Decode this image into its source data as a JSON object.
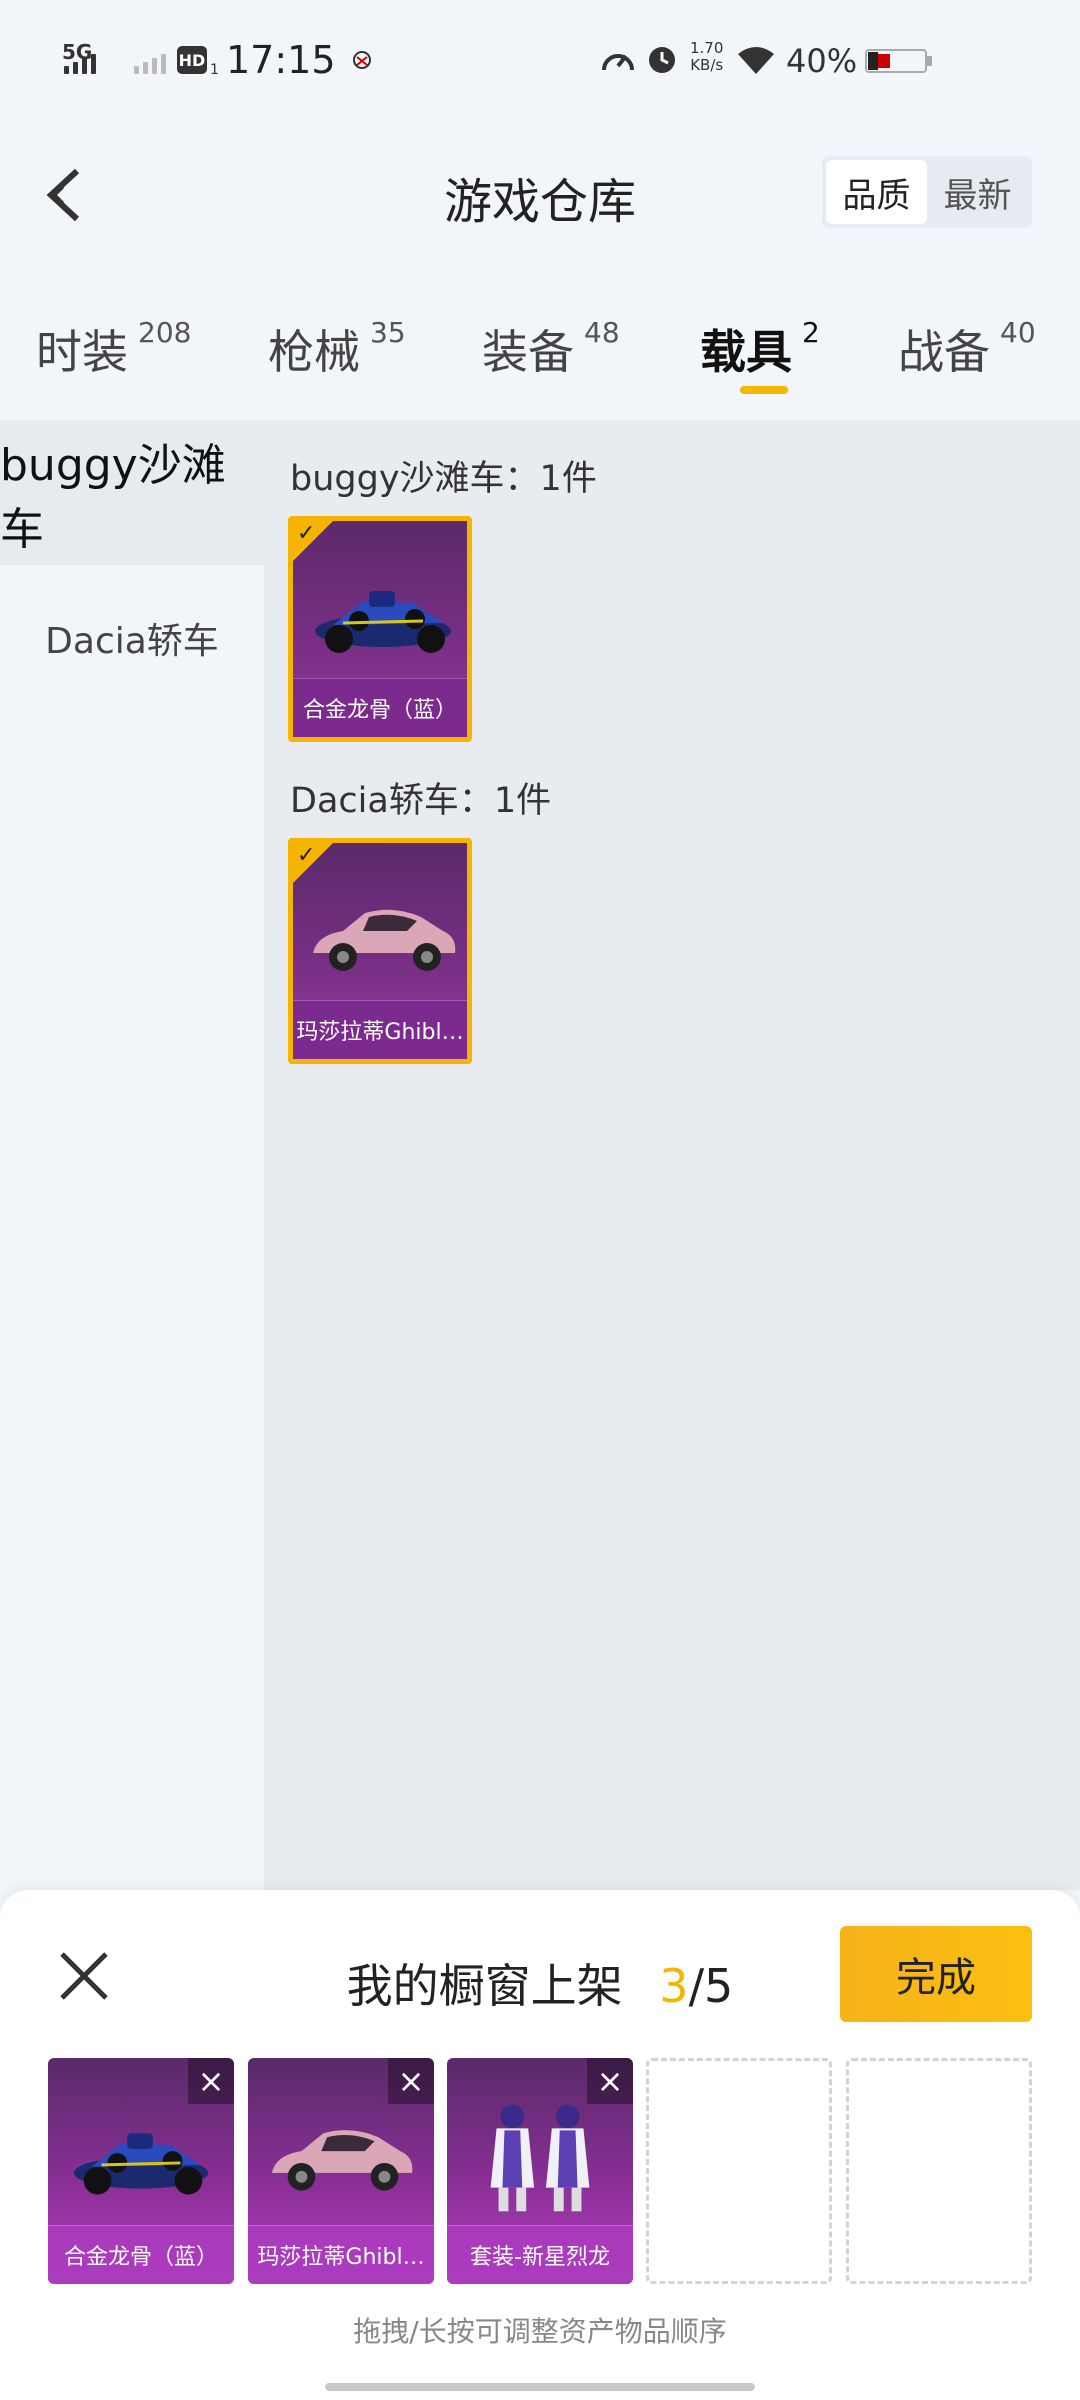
{
  "status_bar": {
    "network": "5G",
    "hd": "HD",
    "hd_sub": "1",
    "time": "17:15",
    "net_speed_value": "1.70",
    "net_speed_unit": "KB/s",
    "battery": "40%"
  },
  "header": {
    "title": "游戏仓库",
    "sort_options": [
      "品质",
      "最新"
    ],
    "active_sort": "品质"
  },
  "categories": [
    {
      "label": "时装",
      "count": "208"
    },
    {
      "label": "枪械",
      "count": "35"
    },
    {
      "label": "装备",
      "count": "48"
    },
    {
      "label": "载具",
      "count": "2"
    },
    {
      "label": "战备",
      "count": "40"
    }
  ],
  "active_category": "载具",
  "sidebar": {
    "items": [
      {
        "label": "buggy沙滩车"
      },
      {
        "label": "Dacia轿车"
      }
    ]
  },
  "groups": [
    {
      "title": "buggy沙滩车：1件",
      "items": [
        {
          "name": "合金龙骨（蓝）",
          "selected": true,
          "icon": "buggy-car-icon"
        }
      ]
    },
    {
      "title": "Dacia轿车：1件",
      "items": [
        {
          "name": "玛莎拉蒂Ghibl…",
          "selected": true,
          "icon": "sedan-car-icon"
        }
      ]
    }
  ],
  "showcase": {
    "title": "我的橱窗上架",
    "current": "3",
    "total": "/5",
    "done_label": "完成",
    "slots": [
      {
        "name": "合金龙骨（蓝）",
        "icon": "buggy-car-icon"
      },
      {
        "name": "玛莎拉蒂Ghibl…",
        "icon": "sedan-car-icon"
      },
      {
        "name": "套装-新星烈龙",
        "icon": "outfit-icon"
      }
    ],
    "empty_slots": 2,
    "hint": "拖拽/长按可调整资产物品顺序"
  },
  "colors": {
    "accent": "#f5b400",
    "item_purple": "#7a2f86",
    "background": "#f2f6fa",
    "content_bg": "#e8ecf0"
  }
}
